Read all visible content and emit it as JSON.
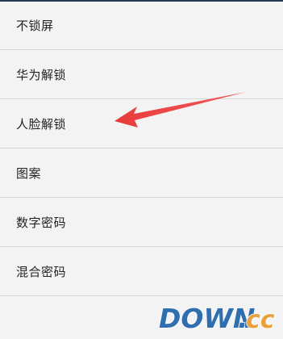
{
  "lock_options": [
    {
      "label": "不锁屏"
    },
    {
      "label": "华为解锁"
    },
    {
      "label": "人脸解锁"
    },
    {
      "label": "图案"
    },
    {
      "label": "数字密码"
    },
    {
      "label": "混合密码"
    }
  ],
  "annotation": {
    "arrow_color": "#e83b3b",
    "target": "人脸解锁"
  },
  "watermark": {
    "text_main": "DOWN",
    "text_dot": ".",
    "text_suffix": "cc",
    "main_color": "#2f6fb0",
    "suffix_color": "#e9a13b"
  },
  "colors": {
    "background": "#f3f3f3",
    "divider": "#d7d7d7",
    "text": "#222222",
    "top_edge": "#1f3a52"
  }
}
